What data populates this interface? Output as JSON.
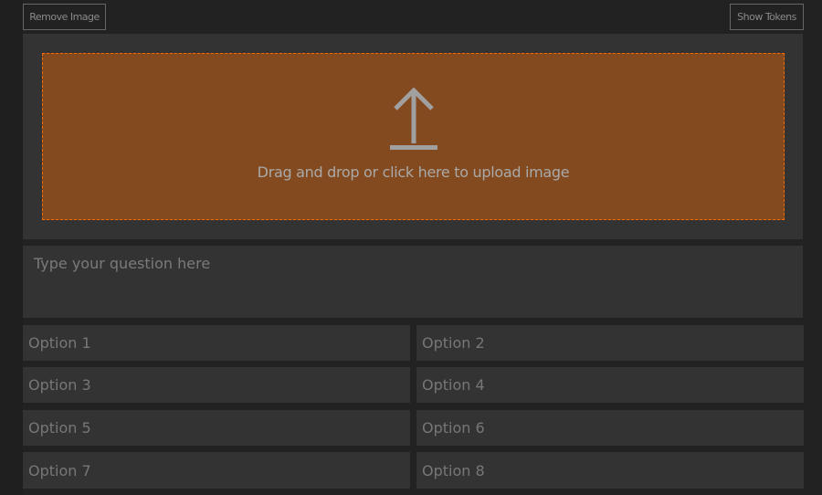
{
  "toolbar": {
    "remove_image": "Remove Image",
    "show_tokens": "Show Tokens"
  },
  "upload": {
    "text": "Drag and drop or click here to upload image",
    "icon": "upload-arrow-icon",
    "accent": "#ff6a00",
    "fill": "#834a1f"
  },
  "question": {
    "placeholder": "Type your question here",
    "value": ""
  },
  "options": [
    {
      "placeholder": "Option 1"
    },
    {
      "placeholder": "Option 2"
    },
    {
      "placeholder": "Option 3"
    },
    {
      "placeholder": "Option 4"
    },
    {
      "placeholder": "Option 5"
    },
    {
      "placeholder": "Option 6"
    },
    {
      "placeholder": "Option 7"
    },
    {
      "placeholder": "Option 8"
    }
  ]
}
